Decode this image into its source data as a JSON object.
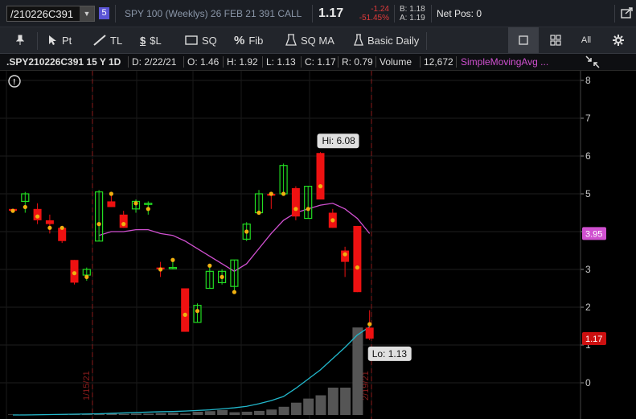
{
  "header": {
    "symbol": "/210226C391",
    "link_number": "5",
    "description": "SPY 100 (Weeklys) 26 FEB 21 391 CALL",
    "last": "1.17",
    "net_change": "-1.24",
    "pct_change": "-51.45%",
    "bid": "B: 1.18",
    "ask": "A: 1.19",
    "net_pos": "Net Pos: 0"
  },
  "toolbar": {
    "pin_icon": "pin-icon",
    "pt_label": "Pt",
    "tl_label": "TL",
    "dollar_label": "$L",
    "sq_label": "SQ",
    "fib_label": "Fib",
    "sqma_label": "SQ MA",
    "basic_label": "Basic Daily",
    "all_label": "All"
  },
  "infobar": {
    "symbol": ".SPY210226C391 15 Y 1D",
    "date": "D: 2/22/21",
    "open": "O: 1.46",
    "high": "H: 1.92",
    "low": "L: 1.13",
    "close": "C: 1.17",
    "range": "R: 0.79",
    "volume_label": "Volume",
    "volume_value": "12,672",
    "study": "SimpleMovingAvg ..."
  },
  "chart_data": {
    "type": "candlestick",
    "ylim": [
      -0.3,
      8.2
    ],
    "y_ticks": [
      "0",
      "1",
      "2",
      "3",
      "4",
      "5",
      "6",
      "7",
      "8"
    ],
    "annotations": {
      "hi_label": "Hi: 6.08",
      "lo_label": "Lo: 1.13",
      "ma_value": "3.95",
      "last_value": "1.17",
      "date_marker_1": "1/15/21",
      "date_marker_2": "2/19/21"
    },
    "colors": {
      "up": "#22dd22",
      "down": "#ee1111",
      "ma": "#d050d0",
      "vol_ma": "#22b8cc",
      "volume": "#555555",
      "dot": "#f0b010"
    },
    "candles": [
      {
        "o": 4.6,
        "h": 4.6,
        "l": 4.5,
        "c": 4.55,
        "d": 4.55
      },
      {
        "o": 4.8,
        "h": 5.05,
        "l": 4.5,
        "c": 5.0,
        "d": 4.65
      },
      {
        "o": 4.6,
        "h": 4.75,
        "l": 4.2,
        "c": 4.3,
        "d": 4.4
      },
      {
        "o": 4.3,
        "h": 4.45,
        "l": 3.95,
        "c": 4.2,
        "d": 4.1
      },
      {
        "o": 4.1,
        "h": 4.15,
        "l": 3.7,
        "c": 3.75,
        "d": 4.1
      },
      {
        "o": 3.25,
        "h": 3.25,
        "l": 2.6,
        "c": 2.65,
        "d": 2.9
      },
      {
        "o": 2.85,
        "h": 3.05,
        "l": 2.7,
        "c": 3.0,
        "d": 2.8
      },
      {
        "o": 3.75,
        "h": 5.1,
        "l": 3.75,
        "c": 5.05,
        "d": 4.2
      },
      {
        "o": 4.8,
        "h": 5.0,
        "l": 4.65,
        "c": 4.65,
        "d": 5.0
      },
      {
        "o": 4.45,
        "h": 4.55,
        "l": 4.1,
        "c": 4.1,
        "d": 4.2
      },
      {
        "o": 4.6,
        "h": 4.85,
        "l": 4.5,
        "c": 4.8,
        "d": 4.75
      },
      {
        "o": 4.75,
        "h": 4.8,
        "l": 4.45,
        "c": 4.75,
        "d": 4.6
      },
      {
        "o": 3.05,
        "h": 3.2,
        "l": 2.8,
        "c": 3.0,
        "d": 3.0
      },
      {
        "o": 3.05,
        "h": 3.3,
        "l": 3.0,
        "c": 3.05,
        "d": 3.25
      },
      {
        "o": 2.5,
        "h": 2.5,
        "l": 1.35,
        "c": 1.35,
        "d": 1.8
      },
      {
        "o": 1.6,
        "h": 2.1,
        "l": 1.6,
        "c": 2.05,
        "d": 1.9
      },
      {
        "o": 2.5,
        "h": 3.1,
        "l": 2.5,
        "c": 2.95,
        "d": 3.1
      },
      {
        "o": 2.65,
        "h": 3.0,
        "l": 2.6,
        "c": 2.95,
        "d": 2.8
      },
      {
        "o": 2.55,
        "h": 3.25,
        "l": 2.4,
        "c": 3.25,
        "d": 2.4
      },
      {
        "o": 3.8,
        "h": 4.25,
        "l": 3.75,
        "c": 4.2,
        "d": 4.0
      },
      {
        "o": 4.5,
        "h": 5.1,
        "l": 4.5,
        "c": 5.0,
        "d": 4.5
      },
      {
        "o": 5.0,
        "h": 5.0,
        "l": 4.6,
        "c": 4.95,
        "d": 5.0
      },
      {
        "o": 5.0,
        "h": 5.8,
        "l": 5.0,
        "c": 5.75,
        "d": 5.0
      },
      {
        "o": 5.15,
        "h": 5.2,
        "l": 4.3,
        "c": 4.4,
        "d": 4.6
      },
      {
        "o": 4.35,
        "h": 5.2,
        "l": 4.35,
        "c": 5.2,
        "d": 4.6
      },
      {
        "o": 6.08,
        "h": 6.1,
        "l": 4.85,
        "c": 4.85,
        "d": 5.2
      },
      {
        "o": 4.5,
        "h": 4.6,
        "l": 4.1,
        "c": 4.1,
        "d": 4.3
      },
      {
        "o": 3.5,
        "h": 3.6,
        "l": 2.8,
        "c": 3.2,
        "d": 3.4
      },
      {
        "o": 4.15,
        "h": 4.15,
        "l": 2.4,
        "c": 2.4,
        "d": 3.05
      },
      {
        "o": 1.46,
        "h": 1.92,
        "l": 1.13,
        "c": 1.17,
        "d": 1.55
      }
    ],
    "ma_series": [
      null,
      null,
      null,
      null,
      null,
      null,
      null,
      3.9,
      4.0,
      4.0,
      4.05,
      4.05,
      3.95,
      3.9,
      3.75,
      3.55,
      3.35,
      3.15,
      2.95,
      3.15,
      3.55,
      3.95,
      4.3,
      4.5,
      4.6,
      4.7,
      4.75,
      4.6,
      4.35,
      3.95
    ],
    "volume": [
      0.02,
      0.02,
      0.02,
      0.02,
      0.02,
      0.03,
      0.03,
      0.04,
      0.05,
      0.04,
      0.05,
      0.05,
      0.07,
      0.08,
      0.05,
      0.12,
      0.14,
      0.18,
      0.1,
      0.12,
      0.15,
      0.2,
      0.3,
      0.45,
      0.6,
      0.72,
      1.0,
      1.0,
      3.2,
      0.0
    ],
    "vol_ma": [
      0.0,
      0.0,
      0.01,
      0.02,
      0.03,
      0.04,
      0.05,
      0.06,
      0.08,
      0.1,
      0.12,
      0.14,
      0.16,
      0.17,
      0.19,
      0.22,
      0.25,
      0.3,
      0.35,
      0.42,
      0.55,
      0.7,
      0.9,
      1.3,
      1.75,
      2.2,
      2.75,
      3.3,
      3.9,
      4.3
    ]
  }
}
